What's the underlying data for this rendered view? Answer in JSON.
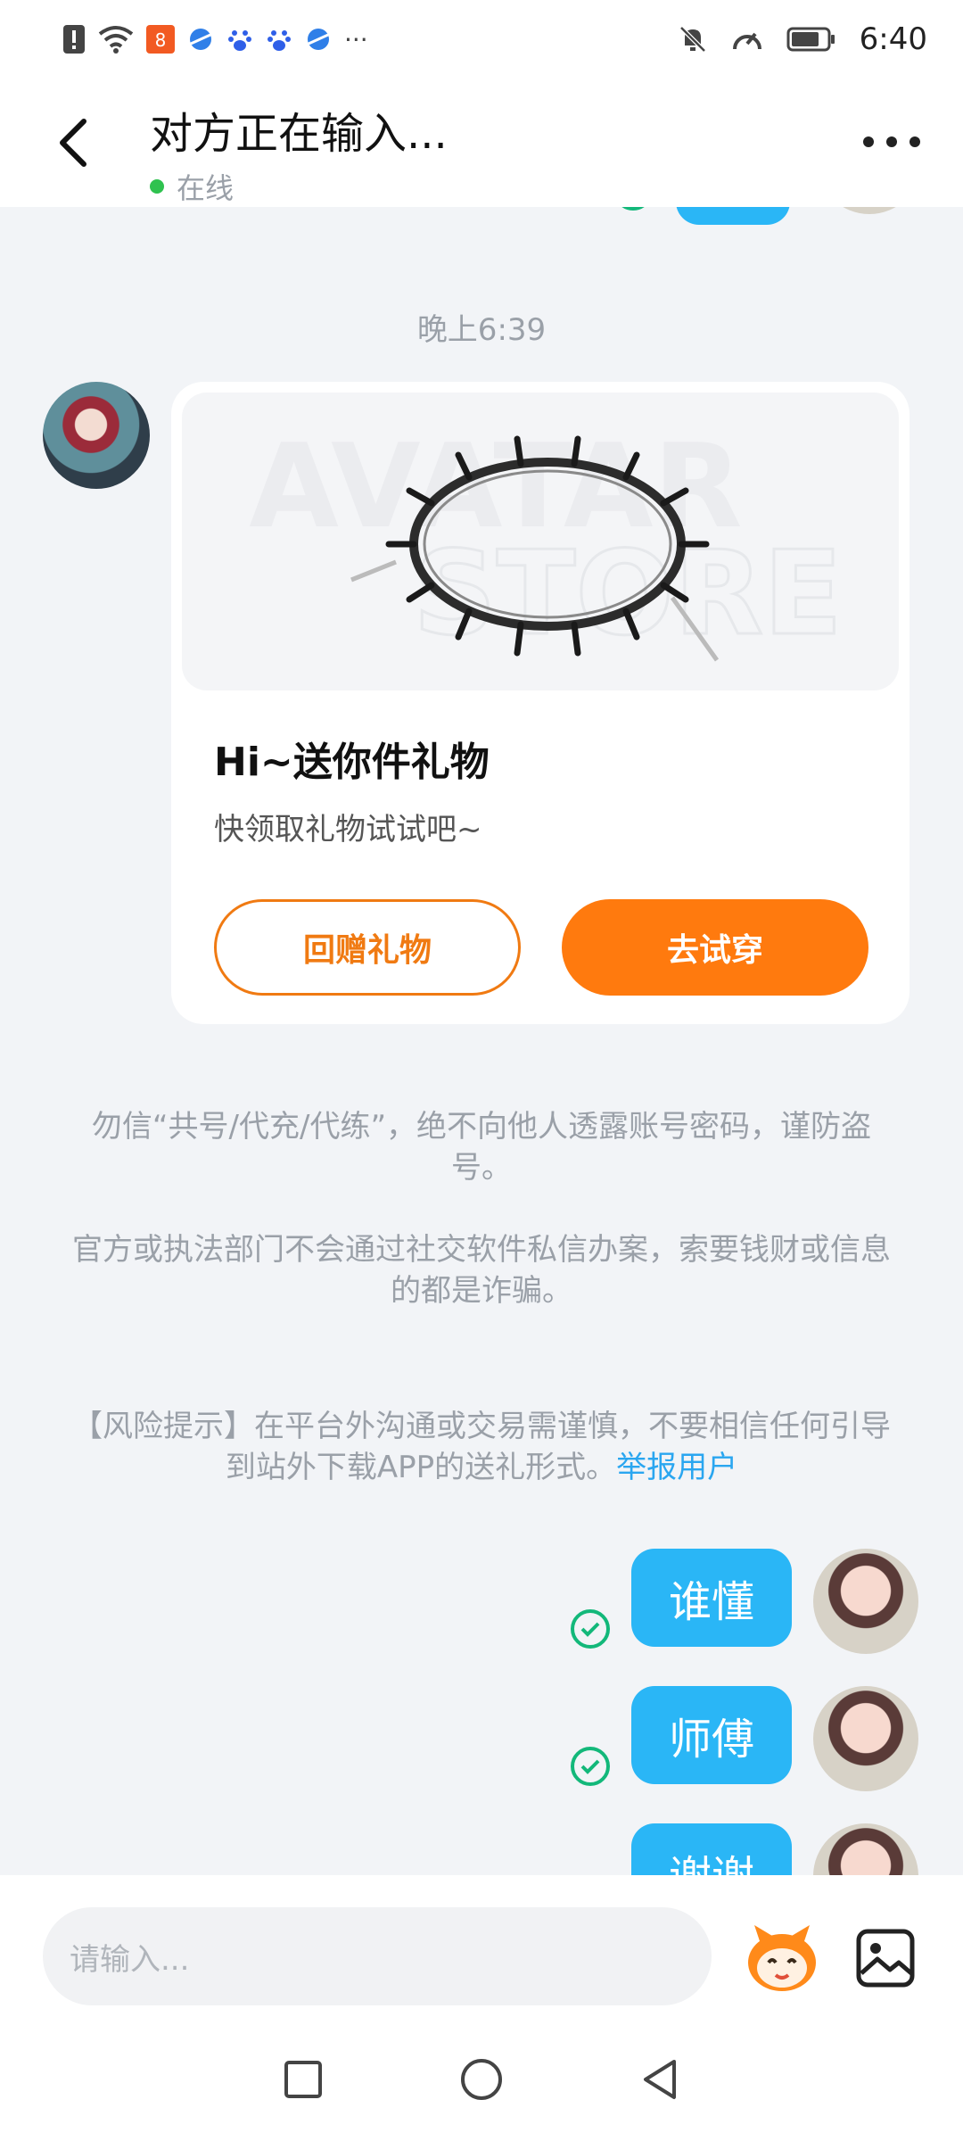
{
  "status_bar": {
    "time": "6:40",
    "left_icons": [
      "alert-icon",
      "wifi-icon",
      "app-icon-red",
      "browser-icon",
      "baidu-icon",
      "baidu-icon",
      "browser-icon",
      "more-dots-icon"
    ],
    "right_icons": [
      "mute-icon",
      "speed-icon",
      "battery-icon"
    ],
    "more": "···"
  },
  "header": {
    "title": "对方正在输入...",
    "status": "在线",
    "status_color": "#2fc24f"
  },
  "chat": {
    "timestamp": "晚上6:39",
    "gift_card": {
      "watermark_line1": "AVATAR",
      "watermark_line2": "STORE",
      "title": "Hi~送你件礼物",
      "description": "快领取礼物试试吧~",
      "return_gift_label": "回赠礼物",
      "try_on_label": "去试穿"
    },
    "notices": [
      "勿信“共号/代充/代练”，绝不向他人透露账号密码，谨防盗号。",
      "官方或执法部门不会通过社交软件私信办案，索要钱财或信息的都是诈骗。"
    ],
    "risk_notice": "【风险提示】在平台外沟通或交易需谨慎，不要相信任何引导到站外下载APP的送礼形式。",
    "report_link": "举报用户",
    "messages": [
      {
        "text": "谁懂",
        "status": "read"
      },
      {
        "text": "师傅",
        "status": "read"
      },
      {
        "text": "谢谢",
        "status": "sent"
      }
    ]
  },
  "input": {
    "placeholder": "请输入..."
  },
  "colors": {
    "accent_orange": "#ff7a0e",
    "bubble_blue": "#2ab6f6",
    "read_check": "#13b87a",
    "link_blue": "#2aa6f0"
  }
}
